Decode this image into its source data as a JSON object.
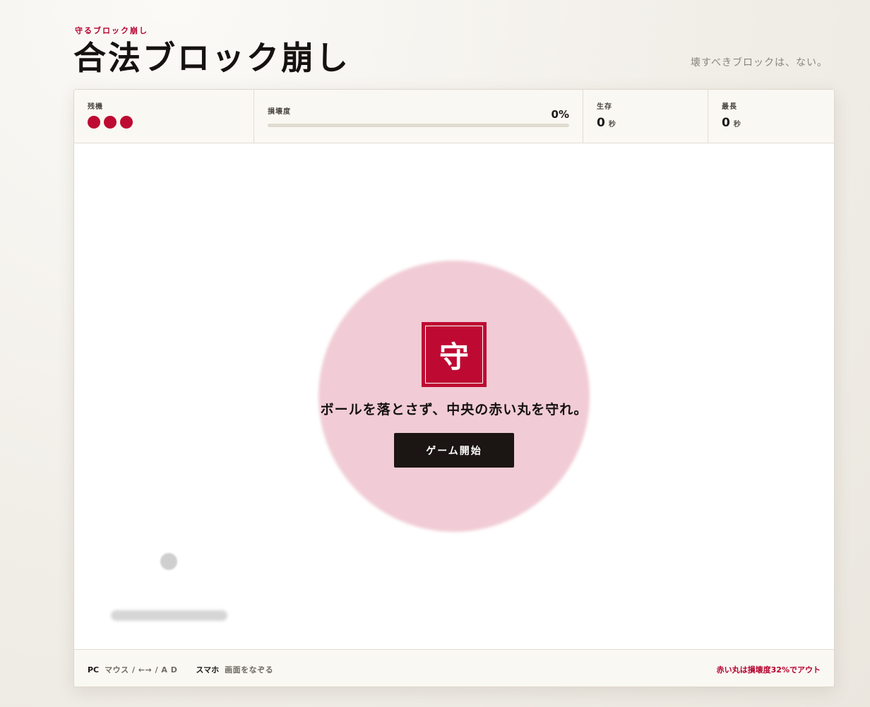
{
  "header": {
    "eyebrow": "守るブロック崩し",
    "title": "合法ブロック崩し",
    "tagline": "壊すべきブロックは、ない。"
  },
  "stats": {
    "lives": {
      "label": "残機",
      "count": 3
    },
    "damage": {
      "label": "損壊度",
      "value": "0%",
      "percent": 0
    },
    "survive": {
      "label": "生存",
      "value": "0",
      "unit": "秒"
    },
    "best": {
      "label": "最長",
      "value": "0",
      "unit": "秒"
    }
  },
  "game": {
    "emblem_char": "守",
    "instruction": "ボールを落とさず、中央の赤い丸を守れ。",
    "start_label": "ゲーム開始"
  },
  "footer": {
    "pc_key": "PC",
    "pc_desc": "マウス / ←→ / A D",
    "sp_key": "スマホ",
    "sp_desc": "画面をなぞる",
    "rule": "赤い丸は損壊度32%でアウト"
  },
  "colors": {
    "accent": "#be0a32",
    "core": "#f1ccd6",
    "button": "#1b1513"
  }
}
